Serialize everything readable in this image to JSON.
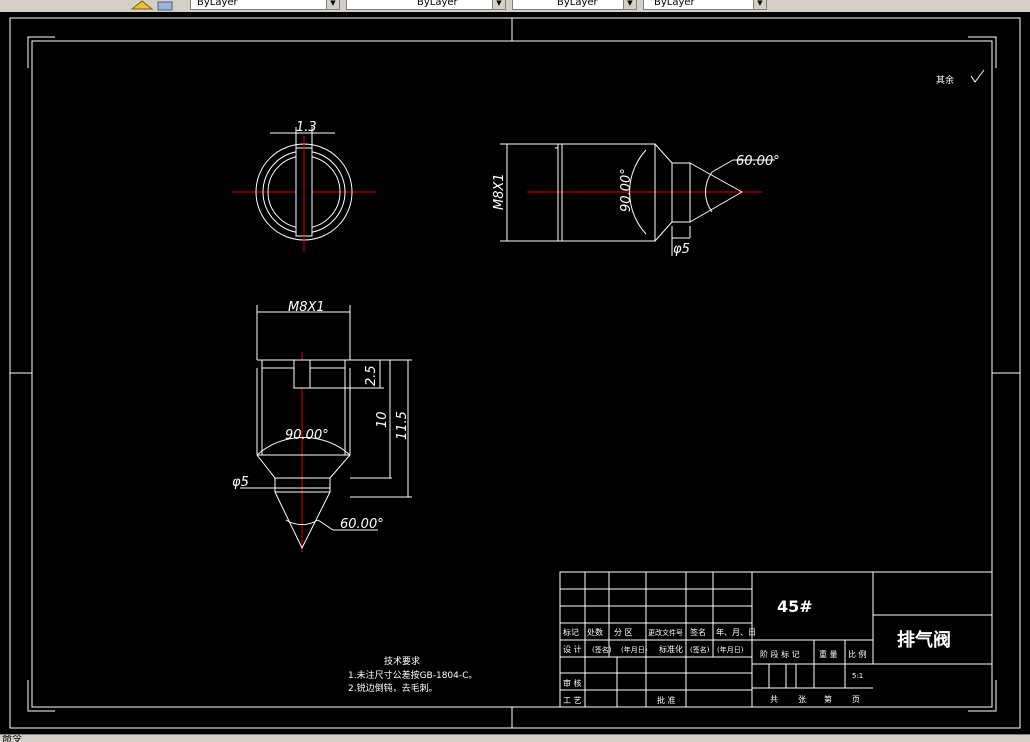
{
  "toolbar": {
    "layer_combo_1": "ByLayer",
    "layer_combo_2": "ByLayer",
    "layer_combo_3": "ByLayer",
    "layer_combo_4": "ByLayer"
  },
  "drawing": {
    "surface_mark": "其余",
    "dims": {
      "slot_width": "1.3",
      "thread_side": "M8X1",
      "cone_angle_side": "90.00°",
      "tip_angle_side": "60.00°",
      "tip_dia_side": "φ5",
      "thread_front": "M8X1",
      "slot_depth": "2.5",
      "thread_len": "10",
      "total_len": "11.5",
      "cone_angle_front": "90.00°",
      "tip_dia_front": "φ5",
      "tip_angle_front": "60.00°"
    },
    "notes": {
      "heading": "技术要求",
      "line1": "1.未注尺寸公差按GB-1804-C。",
      "line2": "2.锐边倒钝，去毛刺。"
    },
    "title_block": {
      "material": "45#",
      "part_name": "排气阀",
      "h_mark": "标记",
      "h_qty": "处数",
      "h_zone": "分  区",
      "h_docno": "更改文件号",
      "h_sign": "签名",
      "h_date": "年、月、日",
      "r_design": "设  计",
      "r_sign1": "(签名)",
      "r_date1": "(年月日)",
      "r_std": "标准化",
      "r_sign2": "(签名)",
      "r_date2": "(年月日)",
      "r_review": "审  核",
      "r_process": "工  艺",
      "r_approve": "批  准",
      "c_stage": "阶 段 标 记",
      "c_weight": "重  量",
      "c_scale": "比 例",
      "scale_value": "5:1",
      "sheets_total": "共",
      "sheets_label": "张",
      "sheet_no": "第",
      "sheet_page": "页"
    }
  },
  "status": {
    "cmd": "命令"
  }
}
